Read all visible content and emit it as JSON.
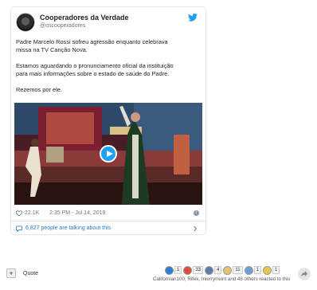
{
  "tweet": {
    "account_name": "Cooperadores da Verdade",
    "account_handle": "@oscooperadores",
    "paragraphs": [
      [
        "Padre Marcelo Rossi sofreu agressão enquanto celebrava",
        "missa na TV Canção Nova."
      ],
      [
        "Estamos aguardando o pronunciamento oficial da instituição",
        "para mais informações sobre o estado de saúde do Padre."
      ],
      [
        "Rezemos por ele."
      ]
    ],
    "likes": "22.1K",
    "timestamp": "2:35 PM - Jul 14, 2019",
    "talking_text": "6,827 people are talking about this"
  },
  "forum": {
    "quote_label": "Quote",
    "plus_symbol": "+",
    "reactions": [
      {
        "count": "1",
        "color": "#2a7fd4"
      },
      {
        "count": "33",
        "color": "#e04b3a"
      },
      {
        "count": "4",
        "color": "#5b7fa8"
      },
      {
        "count": "11",
        "color": "#e8c06a"
      },
      {
        "count": "1",
        "color": "#6aa0d8"
      },
      {
        "count": "1",
        "color": "#e8c84a"
      }
    ],
    "reacted_text": "Californian100, Rifek, Inierryrreint and 48 others reacted to this"
  },
  "colors": {
    "twitter_blue": "#1da1f2",
    "link_blue": "#2b7bb9",
    "muted": "#697882"
  }
}
